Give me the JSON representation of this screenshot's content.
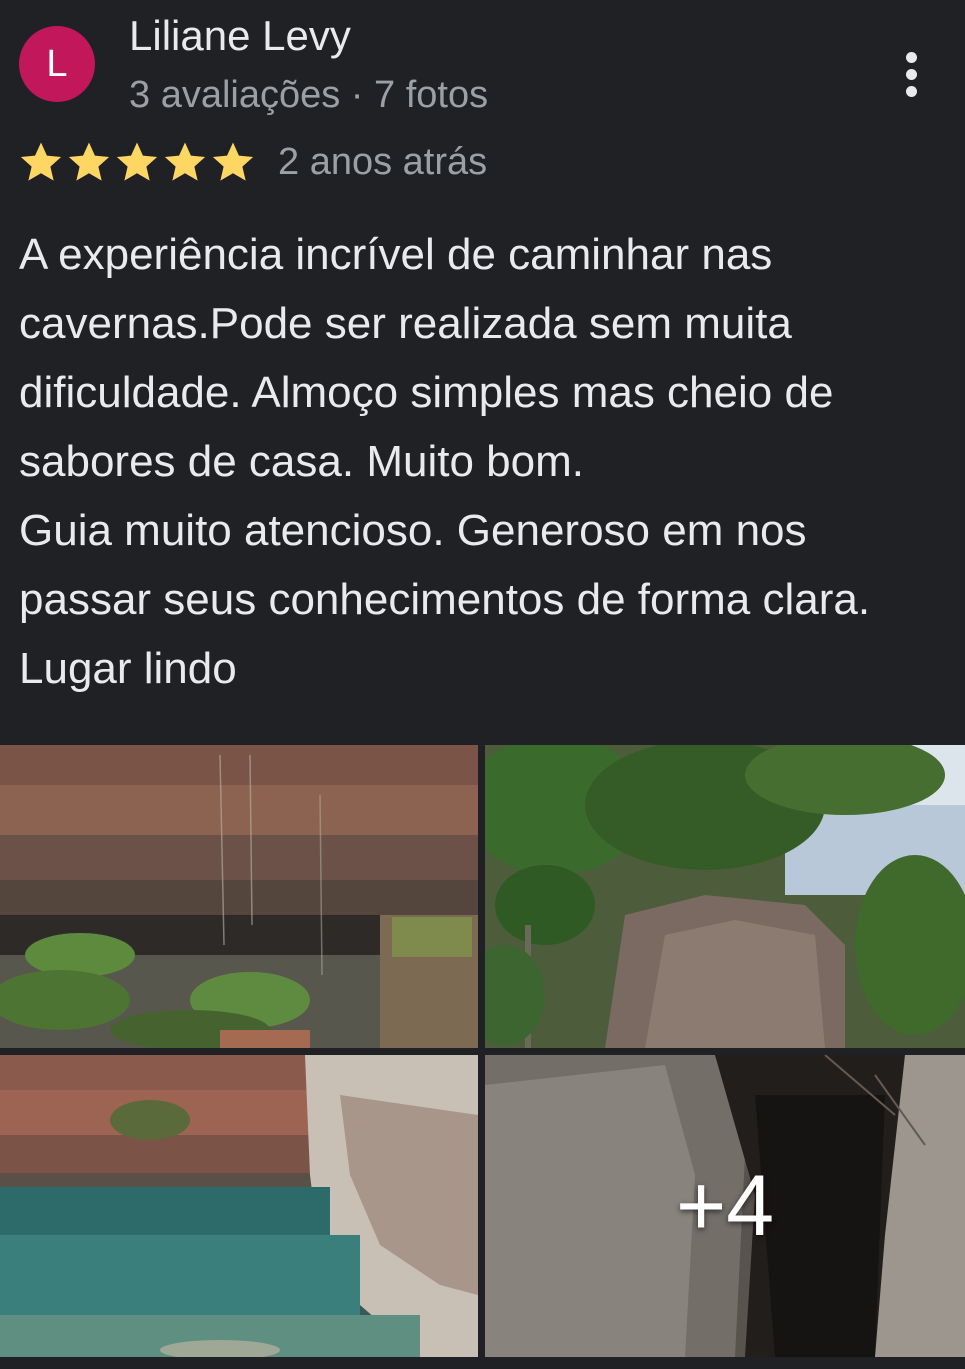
{
  "review": {
    "avatar_initial": "L",
    "reviewer_name": "Liliane Levy",
    "reviewer_meta": "3 avaliações · 7 fotos",
    "rating": 5,
    "rating_max": 5,
    "date": "2 anos atrás",
    "text": "A experiência incrível de caminhar nas\ncavernas.Pode ser realizada sem muita\ndificuldade. Almoço simples mas cheio de\nsabores de casa. Muito bom.\nGuia muito atencioso. Generoso em nos\npassar seus conhecimentos de forma clara.\nLugar lindo"
  },
  "photos": {
    "more_count_label": "+4"
  },
  "icons": {
    "star": "star-icon",
    "more": "more-vert-icon"
  },
  "colors": {
    "background": "#202124",
    "avatar": "#c2185b",
    "star": "#fdd663",
    "primary_text": "#e8eaed",
    "secondary_text": "#9aa0a6"
  }
}
